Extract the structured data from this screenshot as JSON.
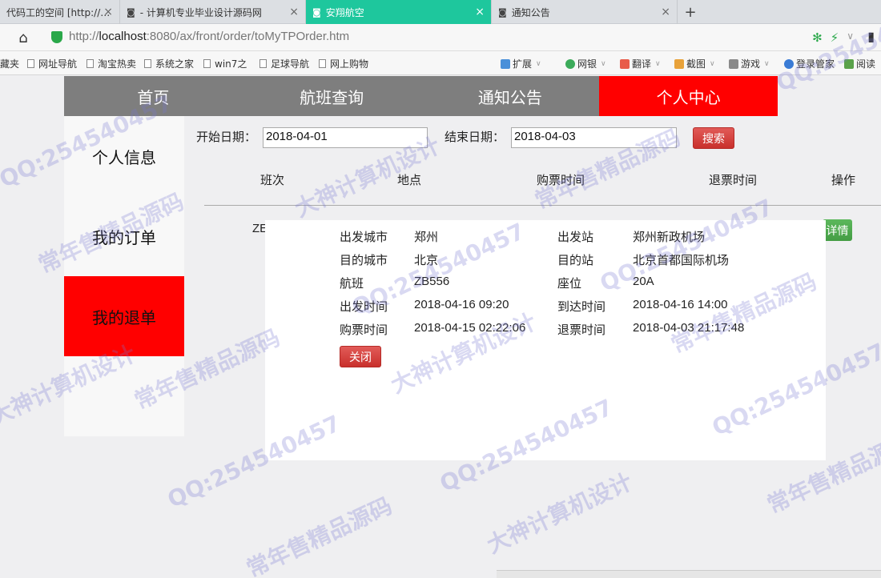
{
  "browser": {
    "tabs": [
      {
        "label": "代码工的空间 [http://…",
        "active": false
      },
      {
        "label": "- 计算机专业毕业设计源码网",
        "active": false
      },
      {
        "label": "安翔航空",
        "active": true
      },
      {
        "label": "通知公告",
        "active": false
      }
    ],
    "tab_close": "×",
    "new_tab": "+",
    "url_prefix": "http://",
    "url_host": "localhost",
    "url_rest": ":8080/ax/front/order/toMyTPOrder.htm",
    "bookmarks": [
      "藏夹",
      "网址导航",
      "淘宝热卖",
      "系统之家",
      "win7之",
      "足球导航",
      "网上购物"
    ],
    "tools": [
      "扩展",
      "网银",
      "翻译",
      "截图",
      "游戏",
      "登录管家",
      "阅读"
    ]
  },
  "nav": {
    "items": [
      "首页",
      "航班查询",
      "通知公告",
      "个人中心"
    ],
    "active_index": 3
  },
  "menu": {
    "items": [
      "个人信息",
      "我的订单",
      "我的退单"
    ],
    "active_index": 2
  },
  "search": {
    "start_label": "开始日期：",
    "start_value": "2018-04-01",
    "end_label": "结束日期：",
    "end_value": "2018-04-03",
    "button": "搜索"
  },
  "table": {
    "headers": [
      "班次",
      "地点",
      "购票时间",
      "退票时间",
      "操作"
    ],
    "row_partial": "ZE",
    "detail_button": "详情"
  },
  "modal": {
    "labels": {
      "dep_city": "出发城市",
      "arr_city": "目的城市",
      "flight": "航班",
      "dep_time": "出发时间",
      "buy_time": "购票时间",
      "dep_station": "出发站",
      "arr_station": "目的站",
      "seat": "座位",
      "arr_time": "到达时间",
      "refund_time": "退票时间"
    },
    "values": {
      "dep_city": "郑州",
      "arr_city": "北京",
      "flight": "ZB556",
      "dep_time": "2018-04-16 09:20",
      "buy_time": "2018-04-15 02:22:06",
      "dep_station": "郑州新政机场",
      "arr_station": "北京首都国际机场",
      "seat": "20A",
      "arr_time": "2018-04-16 14:00",
      "refund_time": "2018-04-03 21:17:48"
    },
    "close_button": "关闭"
  },
  "watermark": {
    "texts": [
      "QQ:254540457",
      "常年售精品源码",
      "大神计算机设计"
    ]
  },
  "colors": {
    "nav_bg": "#7e7e7e",
    "accent_red": "#ff0000",
    "tab_active": "#1ec79d",
    "success_green": "#5cb85c"
  }
}
